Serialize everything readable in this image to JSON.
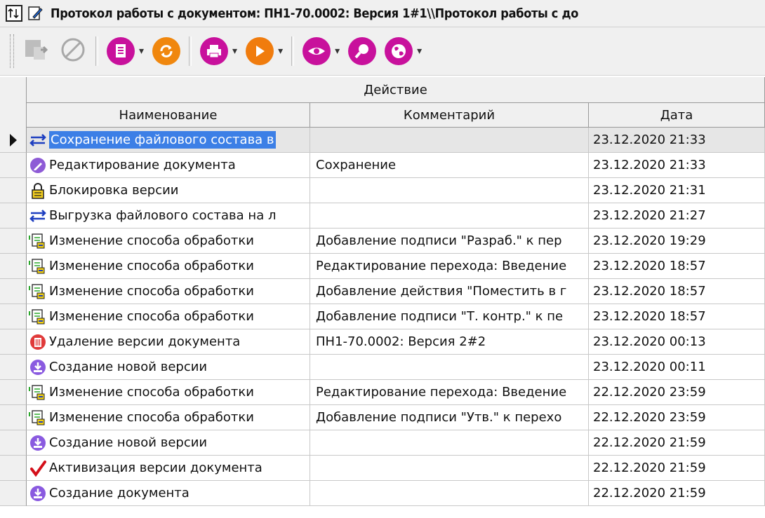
{
  "window": {
    "title": "Протокол работы с документом: ПН1-70.0002: Версия 1#1\\\\Протокол работы с до"
  },
  "toolbar": {
    "buttons": [
      {
        "icon": "open-object-icon",
        "has_dropdown": false,
        "disabled": true
      },
      {
        "icon": "cancel-icon",
        "has_dropdown": false,
        "disabled": true
      },
      {
        "icon": "document-icon",
        "has_dropdown": true,
        "color": "#c0109a"
      },
      {
        "icon": "refresh-icon",
        "has_dropdown": false,
        "color": "#f08a10"
      },
      {
        "icon": "print-icon",
        "has_dropdown": true,
        "color": "#c0109a"
      },
      {
        "icon": "play-icon",
        "has_dropdown": true,
        "color": "#f07c10"
      },
      {
        "icon": "view-icon",
        "has_dropdown": true,
        "color": "#c0109a"
      },
      {
        "icon": "search-icon",
        "has_dropdown": false,
        "color": "#c0109a"
      },
      {
        "icon": "globe-icon",
        "has_dropdown": true,
        "color": "#c0109a"
      }
    ]
  },
  "table": {
    "group_header": "Действие",
    "columns": [
      "Наименование",
      "Комментарий",
      "Дата"
    ],
    "rows": [
      {
        "icon": "transfer-arrows-icon",
        "name": "Сохранение файлового состава в",
        "comment": "",
        "date": "23.12.2020 21:33",
        "selected": true
      },
      {
        "icon": "edit-pencil-icon",
        "name": "Редактирование документа",
        "comment": "Сохранение",
        "date": "23.12.2020 21:33"
      },
      {
        "icon": "lock-icon",
        "name": "Блокировка версии",
        "comment": "",
        "date": "23.12.2020 21:31"
      },
      {
        "icon": "transfer-arrows-icon",
        "name": "Выгрузка файлового состава на л",
        "comment": "",
        "date": "23.12.2020 21:27"
      },
      {
        "icon": "process-change-icon",
        "name": "Изменение способа обработки",
        "comment": "Добавление подписи \"Разраб.\" к пер",
        "date": "23.12.2020 19:29"
      },
      {
        "icon": "process-change-icon",
        "name": "Изменение способа обработки",
        "comment": "Редактирование перехода: Введение",
        "date": "23.12.2020 18:57"
      },
      {
        "icon": "process-change-icon",
        "name": "Изменение способа обработки",
        "comment": "Добавление действия \"Поместить в г",
        "date": "23.12.2020 18:57"
      },
      {
        "icon": "process-change-icon",
        "name": "Изменение способа обработки",
        "comment": "Добавление подписи \"Т. контр.\" к пе",
        "date": "23.12.2020 18:57"
      },
      {
        "icon": "delete-version-icon",
        "name": "Удаление версии документа",
        "comment": "ПН1-70.0002: Версия 2#2",
        "date": "23.12.2020 00:13"
      },
      {
        "icon": "new-version-icon",
        "name": "Создание новой версии",
        "comment": "",
        "date": "23.12.2020 00:11"
      },
      {
        "icon": "process-change-icon",
        "name": "Изменение способа обработки",
        "comment": "Редактирование перехода: Введение",
        "date": "22.12.2020 23:59"
      },
      {
        "icon": "process-change-icon",
        "name": "Изменение способа обработки",
        "comment": "Добавление подписи \"Утв.\" к перехо",
        "date": "22.12.2020 23:59"
      },
      {
        "icon": "new-version-icon",
        "name": "Создание новой версии",
        "comment": "",
        "date": "22.12.2020 21:59"
      },
      {
        "icon": "checkmark-icon",
        "name": "Активизация версии документа",
        "comment": "",
        "date": "22.12.2020 21:59"
      },
      {
        "icon": "new-version-icon",
        "name": "Создание документа",
        "comment": "",
        "date": "22.12.2020 21:59"
      }
    ]
  }
}
